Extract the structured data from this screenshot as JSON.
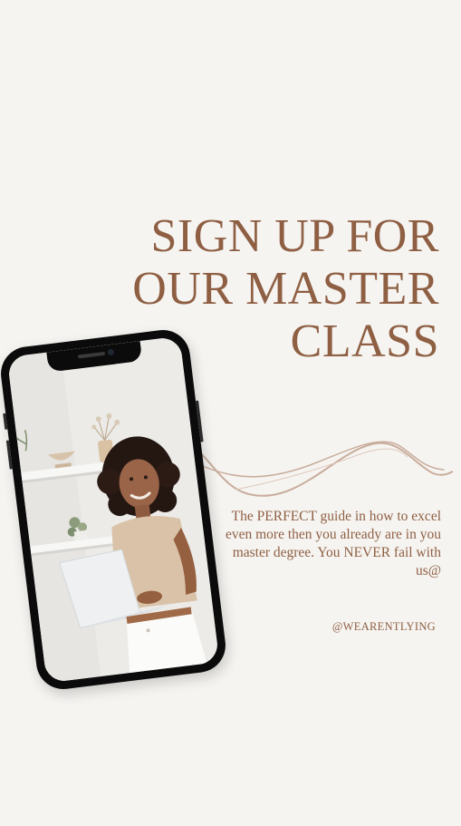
{
  "headline": {
    "line1": "SIGN UP FOR",
    "line2": "OUR MASTER",
    "line3": "CLASS"
  },
  "description": "The PERFECT guide in how to excel even more  then you already are in you master  degree. You NEVER fail with us@",
  "handle": "@WEARENTLYING",
  "colors": {
    "background": "#f6f4f1",
    "accent": "#8e5f43",
    "wave": "#c8ad9c",
    "phone": "#0b0b0b"
  },
  "icons": {
    "decorative_wave": "wave-line-icon",
    "phone": "smartphone-icon"
  }
}
